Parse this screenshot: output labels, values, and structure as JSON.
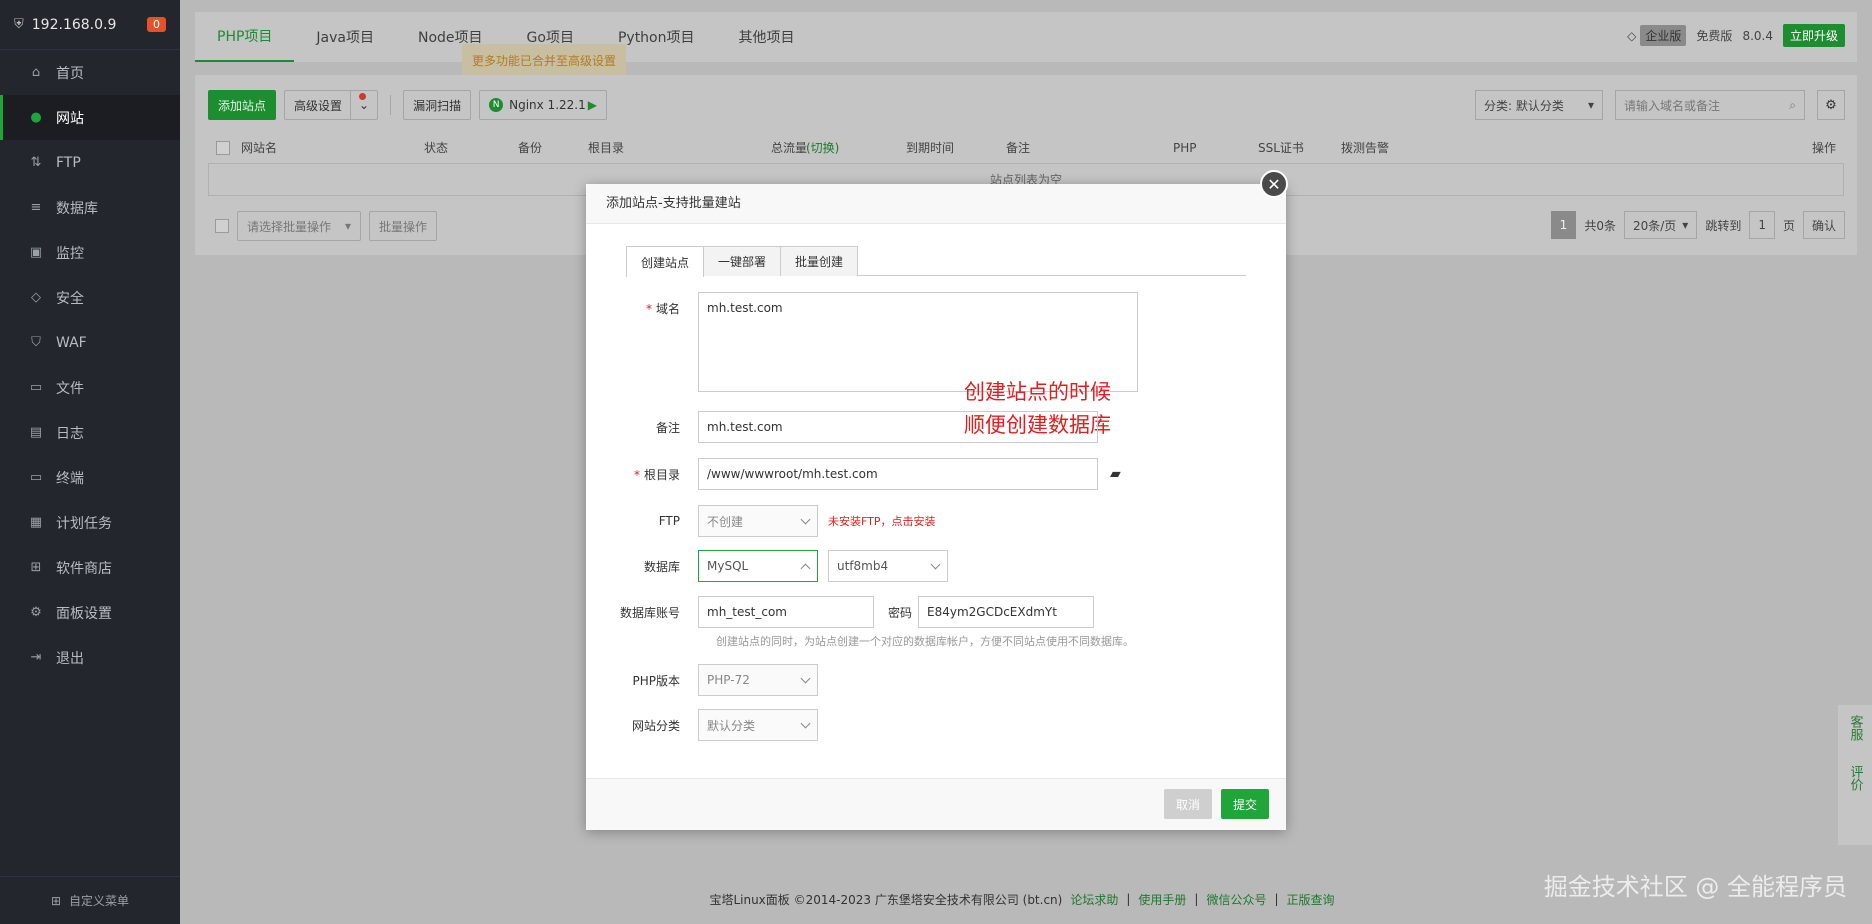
{
  "sidebar": {
    "ip": "192.168.0.9",
    "badge": "0",
    "items": [
      {
        "label": "首页",
        "icon": "home-icon"
      },
      {
        "label": "网站",
        "icon": "globe-icon"
      },
      {
        "label": "FTP",
        "icon": "ftp-icon"
      },
      {
        "label": "数据库",
        "icon": "database-icon"
      },
      {
        "label": "监控",
        "icon": "monitor-icon"
      },
      {
        "label": "安全",
        "icon": "shield-icon"
      },
      {
        "label": "WAF",
        "icon": "waf-icon"
      },
      {
        "label": "文件",
        "icon": "folder-icon"
      },
      {
        "label": "日志",
        "icon": "log-icon"
      },
      {
        "label": "终端",
        "icon": "terminal-icon"
      },
      {
        "label": "计划任务",
        "icon": "calendar-icon"
      },
      {
        "label": "软件商店",
        "icon": "store-icon"
      },
      {
        "label": "面板设置",
        "icon": "settings-icon"
      },
      {
        "label": "退出",
        "icon": "logout-icon"
      }
    ],
    "footer": "自定义菜单"
  },
  "topbar": {
    "tabs": [
      "PHP项目",
      "Java项目",
      "Node项目",
      "Go项目",
      "Python项目",
      "其他项目"
    ],
    "enterprise": "企业版",
    "free": "免费版",
    "version": "8.0.4",
    "upgrade": "立即升级",
    "tooltip": "更多功能已合并至高级设置"
  },
  "toolbar": {
    "add_site": "添加站点",
    "advanced": "高级设置",
    "vuln_scan": "漏洞扫描",
    "nginx": "Nginx 1.22.1",
    "category": "分类: 默认分类",
    "search_placeholder": "请输入域名或备注"
  },
  "table": {
    "columns": [
      "网站名",
      "状态",
      "备份",
      "根目录",
      "总流量",
      "(切换)",
      "到期时间",
      "备注",
      "PHP",
      "SSL证书",
      "拨测告警",
      "操作"
    ],
    "empty": "站点列表为空",
    "batch_placeholder": "请选择批量操作",
    "batch_button": "批量操作"
  },
  "pager": {
    "current": "1",
    "total": "共0条",
    "per_page": "20条/页",
    "jump_label": "跳转到",
    "jump_value": "1",
    "page_unit": "页",
    "confirm": "确认"
  },
  "footer": {
    "copyright": "宝塔Linux面板 ©2014-2023 广东堡塔安全技术有限公司 (bt.cn)",
    "links": [
      "论坛求助",
      "使用手册",
      "微信公众号",
      "正版查询"
    ],
    "watermark": "掘金技术社区 @ 全能程序员"
  },
  "side_float": [
    "客服",
    "评价"
  ],
  "modal": {
    "title": "添加站点-支持批量建站",
    "tabs": [
      "创建站点",
      "一键部署",
      "批量创建"
    ],
    "domain_label": "域名",
    "domain_value": "mh.test.com",
    "remark_label": "备注",
    "remark_value": "mh.test.com",
    "root_label": "根目录",
    "root_value": "/www/wwwroot/mh.test.com",
    "ftp_label": "FTP",
    "ftp_value": "不创建",
    "ftp_note": "未安装FTP，点击安装",
    "db_label": "数据库",
    "db_value": "MySQL",
    "charset_value": "utf8mb4",
    "db_account_label": "数据库账号",
    "db_account_value": "mh_test_com",
    "password_label": "密码",
    "password_value": "E84ym2GCDcEXdmYt",
    "db_hint": "创建站点的同时，为站点创建一个对应的数据库帐户，方便不同站点使用不同数据库。",
    "php_label": "PHP版本",
    "php_value": "PHP-72",
    "category_label": "网站分类",
    "category_value": "默认分类",
    "cancel": "取消",
    "submit": "提交",
    "annotation_line1": "创建站点的时候",
    "annotation_line2": "顺便创建数据库"
  }
}
